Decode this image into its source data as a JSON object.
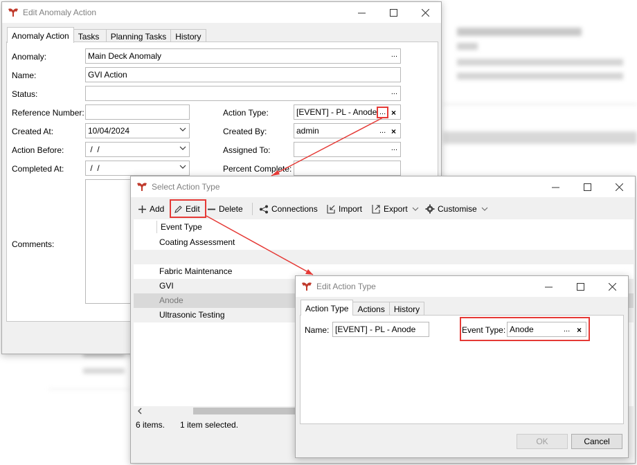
{
  "anomaly_window": {
    "title": "Edit Anomaly Action",
    "tabs": [
      "Anomaly Action",
      "Tasks",
      "Planning Tasks",
      "History"
    ],
    "labels": {
      "anomaly": "Anomaly:",
      "name": "Name:",
      "status": "Status:",
      "reference_number": "Reference Number:",
      "created_at": "Created At:",
      "action_before": "Action Before:",
      "completed_at": "Completed At:",
      "comments": "Comments:",
      "action_type": "Action Type:",
      "created_by": "Created By:",
      "assigned_to": "Assigned To:",
      "percent_complete": "Percent Complete:"
    },
    "values": {
      "anomaly": "Main Deck Anomaly",
      "name": "GVI Action",
      "status": "",
      "reference_number": "",
      "created_at": "10/04/2024",
      "action_before": " /  /",
      "completed_at": " /  /",
      "action_type": "[EVENT] - PL - Anode",
      "created_by": "admin",
      "assigned_to": "",
      "percent_complete": ""
    },
    "ellipsis": "...",
    "clear": "×"
  },
  "select_window": {
    "title": "Select Action Type",
    "toolbar": {
      "add": "Add",
      "edit": "Edit",
      "delete": "Delete",
      "connections": "Connections",
      "import": "Import",
      "export": "Export",
      "customise": "Customise"
    },
    "column_header": "Event Type",
    "rows": [
      "Coating Assessment",
      "",
      "Fabric Maintenance",
      "GVI",
      "Anode",
      "Ultrasonic Testing"
    ],
    "selected_row": "Anode",
    "status": {
      "items": "6 items.",
      "selected": "1 item selected."
    }
  },
  "edit_window": {
    "title": "Edit Action Type",
    "tabs": [
      "Action Type",
      "Actions",
      "History"
    ],
    "name_label": "Name:",
    "name_value": "[EVENT] - PL - Anode",
    "event_type_label": "Event Type:",
    "event_type_value": "Anode",
    "ok": "OK",
    "cancel": "Cancel"
  },
  "colors": {
    "highlight": "#e53935",
    "selection": "#d9d9d9",
    "app_icon": "#c0392b"
  }
}
